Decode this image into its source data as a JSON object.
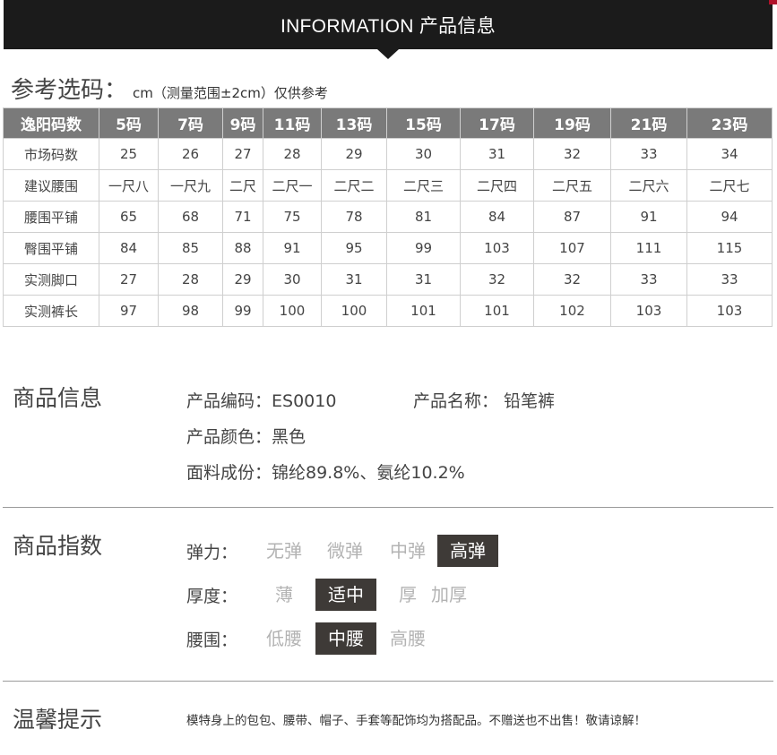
{
  "banner": {
    "title": "INFORMATION 产品信息"
  },
  "size_guide": {
    "title": "参考选码：",
    "note": "cm（测量范围±2cm）仅供参考",
    "header": [
      "逸阳码数",
      "5码",
      "7码",
      "9码",
      "11码",
      "13码",
      "15码",
      "17码",
      "19码",
      "21码",
      "23码"
    ],
    "rows": [
      [
        "市场码数",
        "25",
        "26",
        "27",
        "28",
        "29",
        "30",
        "31",
        "32",
        "33",
        "34"
      ],
      [
        "建议腰围",
        "一尺八",
        "一尺九",
        "二尺",
        "二尺一",
        "二尺二",
        "二尺三",
        "二尺四",
        "二尺五",
        "二尺六",
        "二尺七"
      ],
      [
        "腰围平铺",
        "65",
        "68",
        "71",
        "75",
        "78",
        "81",
        "84",
        "87",
        "91",
        "94"
      ],
      [
        "臀围平铺",
        "84",
        "85",
        "88",
        "91",
        "95",
        "99",
        "103",
        "107",
        "111",
        "115"
      ],
      [
        "实测脚口",
        "27",
        "28",
        "29",
        "30",
        "31",
        "31",
        "32",
        "32",
        "33",
        "33"
      ],
      [
        "实测裤长",
        "97",
        "98",
        "99",
        "100",
        "100",
        "101",
        "101",
        "102",
        "103",
        "103"
      ]
    ]
  },
  "product_info": {
    "title": "商品信息",
    "code": "产品编码：ES0010",
    "name": "产品名称：  铅笔裤",
    "color": "产品颜色：黑色",
    "fabric": "面料成份：锦纶89.8%、氨纶10.2%"
  },
  "product_index": {
    "title": "商品指数",
    "rows": [
      {
        "label": "弹力：",
        "options": [
          "无弹",
          "微弹",
          "中弹",
          "高弹"
        ],
        "selected": "高弹"
      },
      {
        "label": "厚度：",
        "options": [
          "薄",
          "适中",
          "厚",
          "加厚"
        ],
        "selected": "适中"
      },
      {
        "label": "腰围：",
        "options": [
          "低腰",
          "中腰",
          "高腰"
        ],
        "selected": "中腰"
      }
    ]
  },
  "tips": {
    "title": "温馨提示",
    "text": "模特身上的包包、腰带、帽子、手套等配饰均为搭配品。不赠送也不出售！敬请谅解！"
  }
}
